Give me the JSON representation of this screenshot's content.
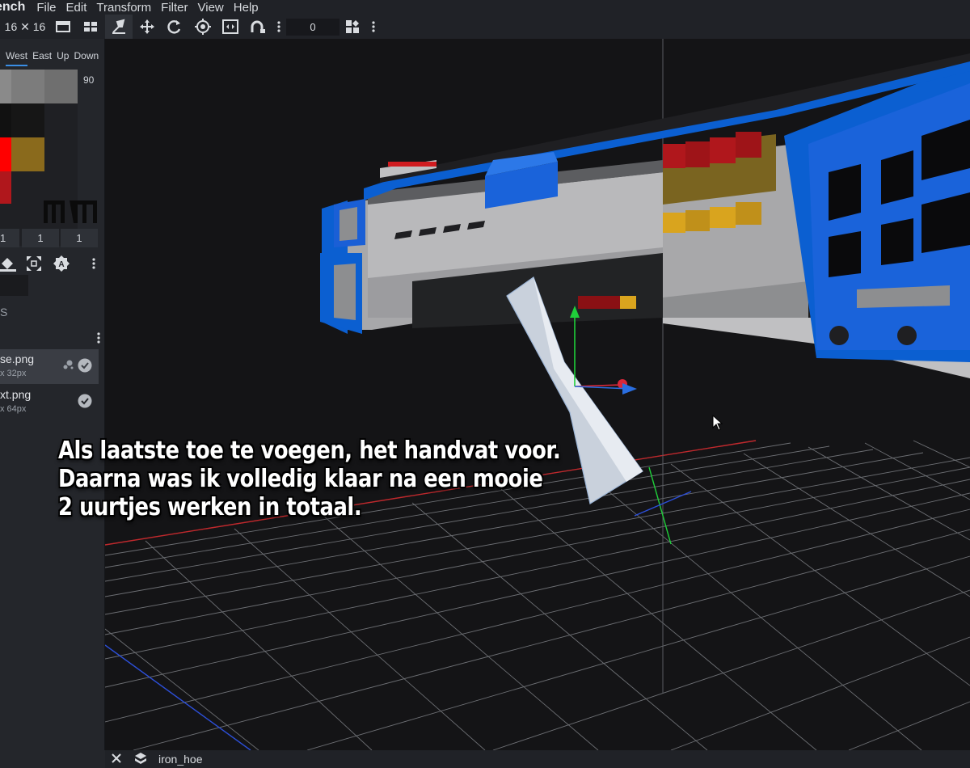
{
  "app": {
    "title_fragment": "ench"
  },
  "menu": [
    "File",
    "Edit",
    "Transform",
    "Filter",
    "View",
    "Help"
  ],
  "toolbar": {
    "size_label": "16 ✕ 16",
    "number_value": "0"
  },
  "uv_panel": {
    "face_tabs": [
      "West",
      "East",
      "Up",
      "Down"
    ],
    "active_tab": "West",
    "rotation": "90",
    "offsets": [
      "1",
      "1",
      "1"
    ],
    "section_label": "S"
  },
  "textures": [
    {
      "name": "se.png",
      "size": "x 32px"
    },
    {
      "name": "xt.png",
      "size": "x 64px"
    }
  ],
  "statusbar": {
    "project_name": "iron_hoe"
  },
  "caption": {
    "lines": [
      "Als laatste toe te voegen, het handvat voor.",
      "Daarna was ik volledig klaar na een mooie",
      "2 uurtjes werken in totaal."
    ]
  },
  "colors": {
    "accent": "#3a8ee6",
    "gun_blue": "#0b5fd1",
    "gun_gray": "#a8a8aa",
    "background": "#141416",
    "panel": "#24262b",
    "shell_red": "#b0171c",
    "shell_gold": "#d9a41e"
  }
}
